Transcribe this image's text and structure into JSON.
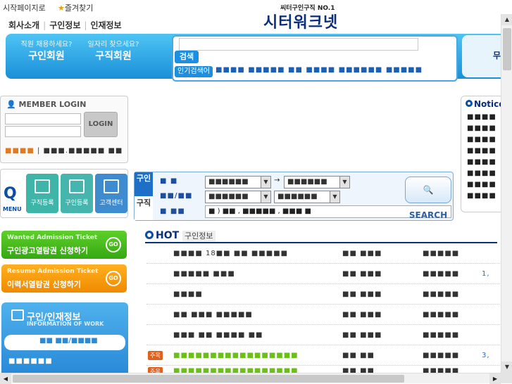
{
  "topbar": {
    "start_label": "시작페이지로",
    "favorites_label": "즐겨찾기"
  },
  "logo": {
    "tagline": "씨터구인구직 NO.1",
    "name": "시터워크넷"
  },
  "topnav": {
    "items": [
      "회사소개",
      "구인정보",
      "인재정보"
    ]
  },
  "band": {
    "employer_question": "직원 채용하세요?",
    "employer_label": "구인회원",
    "seeker_question": "일자리 찾으세요?",
    "seeker_label": "구직회원",
    "search_button": "검색",
    "popular_label": "인기검색어",
    "popular_words": "■■■■ ■■■■■ ■■ ■■■■ ■■■■■■ ■■■■■",
    "right_label": "무료"
  },
  "login": {
    "title": "MEMBER LOGIN",
    "button": "LOGIN",
    "link_left": "■■■■",
    "link_right": "■■■.■■■■■ ■■"
  },
  "quick": {
    "q": "Q",
    "menu": "MENU",
    "buttons": [
      "구직등록",
      "구인등록",
      "고객센터"
    ],
    "colors": [
      "#3fb4a8",
      "#45b5ad",
      "#3e8bd0"
    ]
  },
  "tickets": {
    "wanted_en": "Wanted Admission Ticket",
    "wanted_ko": "구인광고열람권 신청하기",
    "resume_en": "Resume Admission Ticket",
    "resume_ko": "이력서열람권 신청하기",
    "go": "GO"
  },
  "info": {
    "title": "구인/인재정보",
    "subtitle": "INFORMATION OF WORK",
    "tab1": "■■ ■■/■■■■",
    "tab2": "■■■■■■"
  },
  "search_panel": {
    "tab_find_people": "구인",
    "tab_find_job": "구직",
    "row1_label": "■ ■",
    "row2_label": "■■/■■",
    "row3_label": "■ ■■",
    "sel_a": "■■■■■■",
    "sel_b": "■■■■■■",
    "sel_c": "■■■■■■",
    "sel_d": "■■■■■■",
    "arrow": "→",
    "keyword": "■ ) ■■ , ■■■■■ , ■■■ ■",
    "search_button": "SEARCH"
  },
  "notice": {
    "title": "Notice",
    "items": [
      "■■■■",
      "■■■■",
      "■■■■",
      "■■■■",
      "■■■■",
      "■■■■",
      "■■■■",
      "■■■■"
    ]
  },
  "hot": {
    "title": "HOT",
    "subtitle": "구인정보",
    "rows": [
      {
        "badge": "",
        "c1": "■■■■ 18■■ ■■ ■■■■■",
        "c2": "■■ ■■■",
        "c3": "■■■■■",
        "c4": ""
      },
      {
        "badge": "",
        "c1": "■■■■■ ■■■",
        "c2": "■■ ■■■",
        "c3": "■■■■■",
        "c4": "1,"
      },
      {
        "badge": "",
        "c1": "■■■■",
        "c2": "■■ ■■■",
        "c3": "■■■■■",
        "c4": ""
      },
      {
        "badge": "",
        "c1": "■■ ■■■ ■■■■■",
        "c2": "■■ ■■■",
        "c3": "■■■■■",
        "c4": ""
      },
      {
        "badge": "",
        "c1": "■■■ ■■ ■■■■ ■■",
        "c2": "■■ ■■■",
        "c3": "■■■■■",
        "c4": ""
      },
      {
        "badge": "주목",
        "c1": "■■■■■■■■■■■■■■■■■",
        "c2": "■■ ■■",
        "c3": "■■■■■",
        "c4": "3,"
      },
      {
        "badge": "주목",
        "c1": "■■■■■■■■■■■■■■■■■",
        "c2": "■■ ■■",
        "c3": "■■■■■",
        "c4": ""
      }
    ]
  }
}
